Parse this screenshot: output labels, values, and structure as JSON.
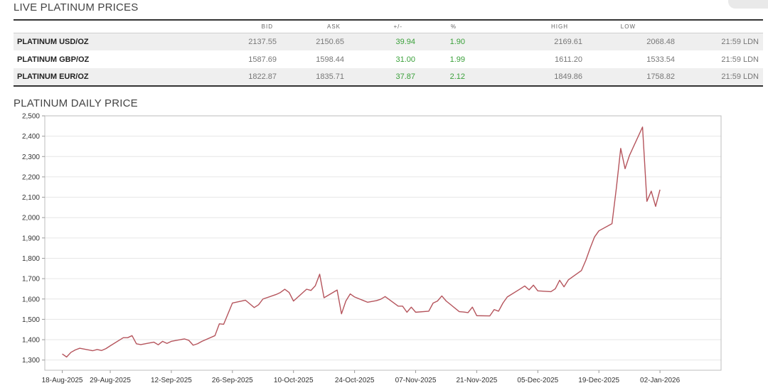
{
  "prices_section": {
    "title": "LIVE PLATINUM PRICES",
    "columns": [
      "",
      "BID",
      "ASK",
      "+/-",
      "%",
      "HIGH",
      "LOW",
      ""
    ],
    "rows": [
      {
        "name": "PLATINUM USD/OZ",
        "bid": "2137.55",
        "ask": "2150.65",
        "change": "39.94",
        "percent": "1.90",
        "high": "2169.61",
        "low": "2068.48",
        "time": "21:59 LDN"
      },
      {
        "name": "PLATINUM GBP/OZ",
        "bid": "1587.69",
        "ask": "1598.44",
        "change": "31.00",
        "percent": "1.99",
        "high": "1611.20",
        "low": "1533.54",
        "time": "21:59 LDN"
      },
      {
        "name": "PLATINUM EUR/OZ",
        "bid": "1822.87",
        "ask": "1835.71",
        "change": "37.87",
        "percent": "2.12",
        "high": "1849.86",
        "low": "1758.82",
        "time": "21:59 LDN"
      }
    ]
  },
  "chart_section": {
    "title": "PLATINUM DAILY PRICE"
  },
  "colors": {
    "line": "#b5545c",
    "positive": "#3aa03a",
    "grid": "#e6e6e6",
    "axis": "#999999"
  },
  "chart_data": {
    "type": "line",
    "title": "PLATINUM DAILY PRICE",
    "xlabel": "",
    "ylabel": "",
    "ylim": [
      1250,
      2500
    ],
    "yticks": [
      1300,
      1400,
      1500,
      1600,
      1700,
      1800,
      1900,
      2000,
      2100,
      2200,
      2300,
      2400,
      2500
    ],
    "ytick_labels": [
      "1,300",
      "1,400",
      "1,500",
      "1,600",
      "1,700",
      "1,800",
      "1,900",
      "2,000",
      "2,100",
      "2,200",
      "2,300",
      "2,400",
      "2,500"
    ],
    "xlim": [
      "2025-08-14",
      "2026-01-16"
    ],
    "xticks": [
      "2025-08-18",
      "2025-08-29",
      "2025-09-12",
      "2025-09-26",
      "2025-10-10",
      "2025-10-24",
      "2025-11-07",
      "2025-11-21",
      "2025-12-05",
      "2025-12-19",
      "2026-01-02"
    ],
    "xtick_labels": [
      "18-Aug-2025",
      "29-Aug-2025",
      "12-Sep-2025",
      "26-Sep-2025",
      "10-Oct-2025",
      "24-Oct-2025",
      "07-Nov-2025",
      "21-Nov-2025",
      "05-Dec-2025",
      "19-Dec-2025",
      "02-Jan-2026"
    ],
    "grid": true,
    "legend": "none",
    "series": [
      {
        "x": [
          "2025-08-18",
          "2025-08-19",
          "2025-08-20",
          "2025-08-21",
          "2025-08-22",
          "2025-08-25",
          "2025-08-26",
          "2025-08-27",
          "2025-08-28",
          "2025-08-29",
          "2025-09-01",
          "2025-09-02",
          "2025-09-03",
          "2025-09-04",
          "2025-09-05",
          "2025-09-08",
          "2025-09-09",
          "2025-09-10",
          "2025-09-11",
          "2025-09-12",
          "2025-09-15",
          "2025-09-16",
          "2025-09-17",
          "2025-09-18",
          "2025-09-19",
          "2025-09-22",
          "2025-09-23",
          "2025-09-24",
          "2025-09-25",
          "2025-09-26",
          "2025-09-29",
          "2025-09-30",
          "2025-10-01",
          "2025-10-02",
          "2025-10-03",
          "2025-10-06",
          "2025-10-07",
          "2025-10-08",
          "2025-10-09",
          "2025-10-10",
          "2025-10-13",
          "2025-10-14",
          "2025-10-15",
          "2025-10-16",
          "2025-10-17",
          "2025-10-20",
          "2025-10-21",
          "2025-10-22",
          "2025-10-23",
          "2025-10-24",
          "2025-10-27",
          "2025-10-28",
          "2025-10-29",
          "2025-10-30",
          "2025-10-31",
          "2025-11-03",
          "2025-11-04",
          "2025-11-05",
          "2025-11-06",
          "2025-11-07",
          "2025-11-10",
          "2025-11-11",
          "2025-11-12",
          "2025-11-13",
          "2025-11-14",
          "2025-11-17",
          "2025-11-18",
          "2025-11-19",
          "2025-11-20",
          "2025-11-21",
          "2025-11-24",
          "2025-11-25",
          "2025-11-26",
          "2025-11-27",
          "2025-11-28",
          "2025-12-01",
          "2025-12-02",
          "2025-12-03",
          "2025-12-04",
          "2025-12-05",
          "2025-12-08",
          "2025-12-09",
          "2025-12-10",
          "2025-12-11",
          "2025-12-12",
          "2025-12-15",
          "2025-12-16",
          "2025-12-17",
          "2025-12-18",
          "2025-12-19",
          "2025-12-22",
          "2025-12-23",
          "2025-12-24",
          "2025-12-25",
          "2025-12-26",
          "2025-12-29",
          "2025-12-30",
          "2025-12-31",
          "2026-01-01",
          "2026-01-02"
        ],
        "y": [
          1330,
          1315,
          1338,
          1350,
          1358,
          1346,
          1352,
          1347,
          1356,
          1370,
          1410,
          1410,
          1420,
          1380,
          1376,
          1388,
          1375,
          1392,
          1382,
          1392,
          1404,
          1397,
          1373,
          1380,
          1392,
          1420,
          1478,
          1476,
          1528,
          1580,
          1594,
          1576,
          1558,
          1572,
          1600,
          1622,
          1632,
          1648,
          1632,
          1590,
          1648,
          1642,
          1665,
          1722,
          1606,
          1644,
          1527,
          1590,
          1625,
          1610,
          1584,
          1588,
          1592,
          1599,
          1612,
          1565,
          1565,
          1535,
          1560,
          1535,
          1540,
          1580,
          1590,
          1615,
          1590,
          1538,
          1536,
          1533,
          1560,
          1518,
          1517,
          1548,
          1540,
          1580,
          1610,
          1650,
          1664,
          1645,
          1668,
          1640,
          1636,
          1650,
          1692,
          1660,
          1694,
          1740,
          1790,
          1850,
          1905,
          1935,
          1970,
          2145,
          2340,
          2240,
          2305,
          2445,
          2080,
          2130,
          2055,
          2137
        ]
      }
    ]
  }
}
